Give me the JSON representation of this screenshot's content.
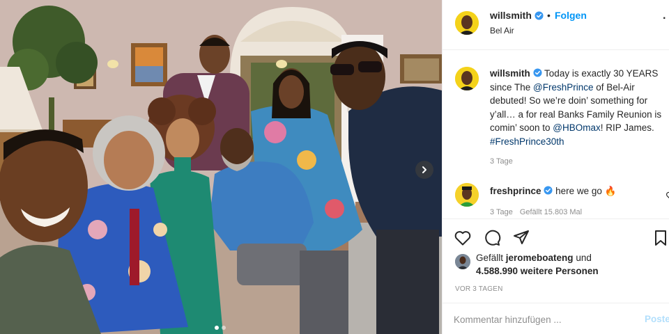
{
  "post": {
    "author": {
      "username": "willsmith",
      "verified": true,
      "follow_label": "Folgen",
      "separator": "•",
      "location": "Bel Air",
      "avatar_icon": "avatar-willsmith"
    },
    "more_icon": "more-options-icon",
    "more_label": "·",
    "photo": {
      "description_icon": "group-selfie-photo",
      "carousel_total": 2,
      "carousel_active": 1,
      "next_icon": "chevron-right-icon"
    },
    "caption": {
      "username": "willsmith",
      "text_1": "Today is exactly 30 YEARS since The ",
      "mention_1": "@FreshPrince",
      "text_2": " of Bel-Air debuted! So we’re doin’ something for y’all… a for real Banks Family Reunion is comin’ soon to ",
      "mention_2": "@HBOmax",
      "text_3": "! RIP James. ",
      "hashtag": "#FreshPrince30th",
      "time": "3 Tage"
    },
    "comment": {
      "username": "freshprince",
      "verified": true,
      "text": "here we go 🔥",
      "time": "3 Tage",
      "likes": "Gefällt 15.803 Mal",
      "like_icon": "heart-outline-icon"
    },
    "actions": {
      "like_icon": "heart-icon",
      "comment_icon": "comment-bubble-icon",
      "share_icon": "paper-plane-icon",
      "save_icon": "bookmark-icon"
    },
    "likes": {
      "prefix": "Gefällt ",
      "user": "jeromeboateng",
      "suffix": " und",
      "others": "4.588.990 weitere Personen"
    },
    "timestamp": "VOR 3 TAGEN",
    "comment_input": {
      "placeholder": "Kommentar hinzufügen ...",
      "post_label": "Posten"
    },
    "colors": {
      "link_blue": "#0095f6",
      "mention_blue": "#00376b",
      "verified_blue": "#3897f0",
      "muted": "#8e8e8e",
      "border": "#efefef"
    }
  }
}
